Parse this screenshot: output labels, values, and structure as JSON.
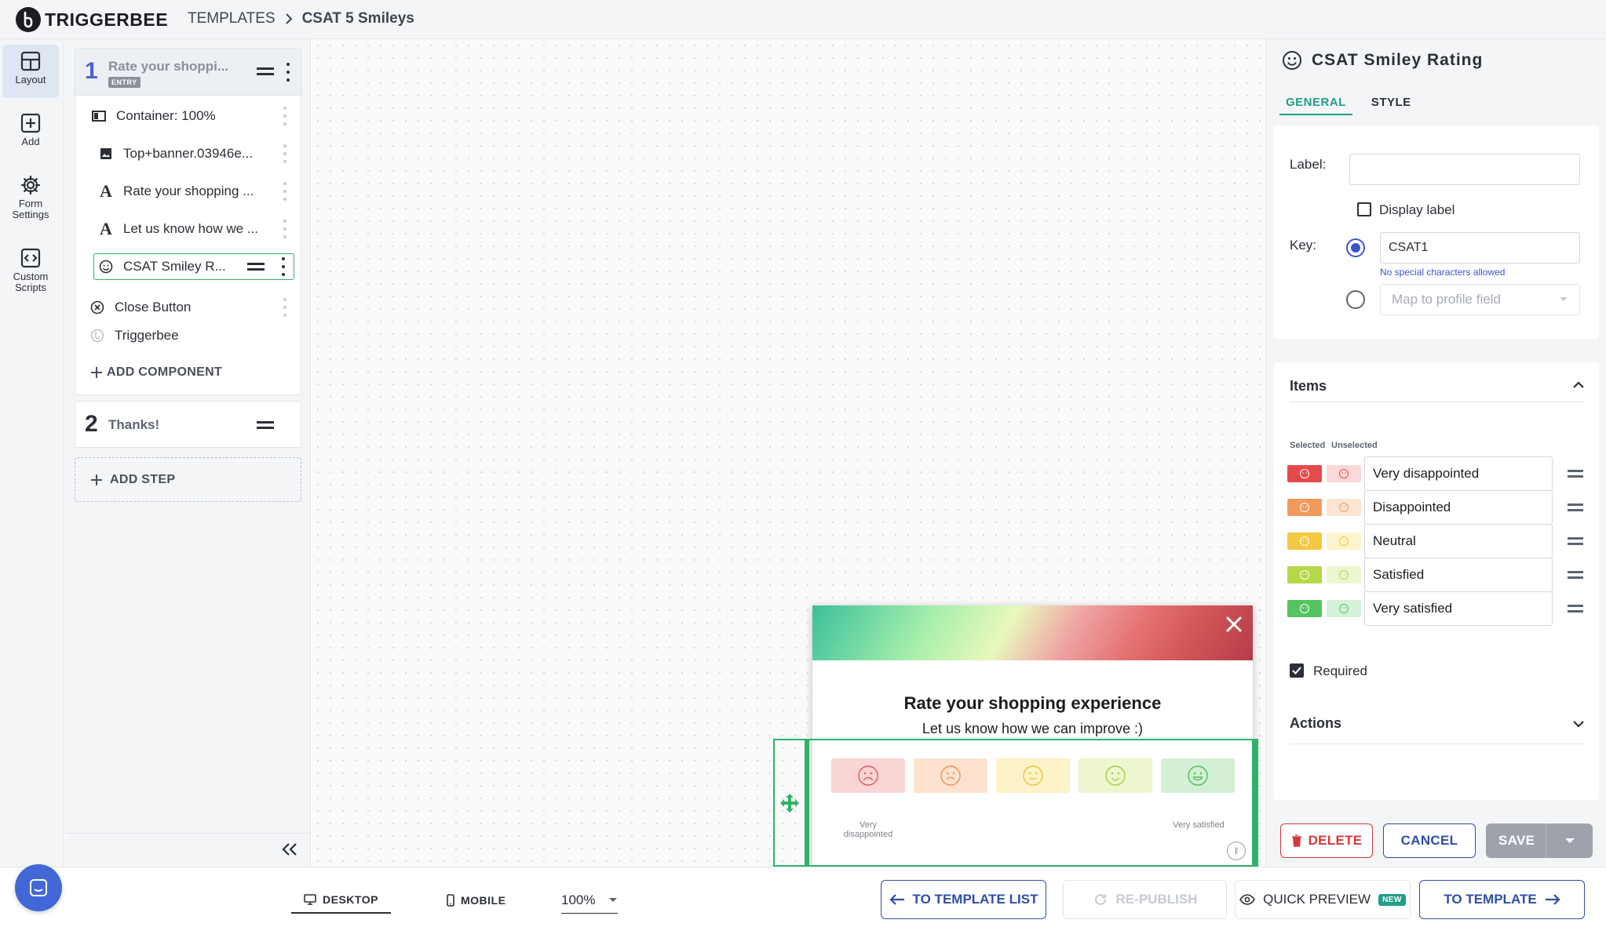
{
  "app": {
    "brand": "TRIGGERBEE"
  },
  "breadcrumb": {
    "root": "TEMPLATES",
    "separator": ">",
    "current": "CSAT 5 Smileys"
  },
  "rail": {
    "layout": "Layout",
    "add": "Add",
    "form_settings": "Form Settings",
    "custom_scripts": "Custom Scripts"
  },
  "steps": {
    "step1": {
      "number": "1",
      "title": "Rate your shoppi...",
      "badge": "ENTRY",
      "components": [
        {
          "label": "Container: 100%",
          "icon": "container-icon"
        },
        {
          "label": "Top+banner.03946e...",
          "icon": "image-icon"
        },
        {
          "label": "Rate your shopping ...",
          "icon": "text-icon"
        },
        {
          "label": "Let us know how we ...",
          "icon": "text-icon"
        },
        {
          "label": "CSAT Smiley R...",
          "icon": "smiley-icon"
        },
        {
          "label": "Close Button",
          "icon": "close-circle-icon"
        },
        {
          "label": "Triggerbee",
          "icon": "triggerbee-icon"
        }
      ],
      "add_component": "ADD COMPONENT"
    },
    "step2": {
      "number": "2",
      "title": "Thanks!"
    },
    "add_step": "ADD STEP"
  },
  "popup": {
    "title": "Rate your shopping experience",
    "subtitle": "Let us know how we can improve :)",
    "scale_low": "Very disappointed",
    "scale_high": "Very satisfied"
  },
  "props": {
    "title": "CSAT Smiley Rating",
    "tabs": {
      "general": "GENERAL",
      "style": "STYLE"
    },
    "general": {
      "label_field": "Label:",
      "label_value": "",
      "display_label": "Display label",
      "key_field": "Key:",
      "key_value": "CSAT1",
      "key_hint": "No special characters allowed",
      "map_placeholder": "Map to profile field"
    },
    "items": {
      "heading": "Items",
      "selected_lbl": "Selected",
      "unselected_lbl": "Unselected",
      "list": [
        {
          "label": "Very disappointed",
          "selected": "#e64b4b",
          "unselected": "#fbd9d9"
        },
        {
          "label": "Disappointed",
          "selected": "#f29a5c",
          "unselected": "#fde5d2"
        },
        {
          "label": "Neutral",
          "selected": "#f5c842",
          "unselected": "#fdf4cc"
        },
        {
          "label": "Satisfied",
          "selected": "#b5d848",
          "unselected": "#edf6cf"
        },
        {
          "label": "Very satisfied",
          "selected": "#55c460",
          "unselected": "#d6f1d8"
        }
      ],
      "required": "Required"
    },
    "actions_heading": "Actions",
    "buttons": {
      "delete": "DELETE",
      "cancel": "CANCEL",
      "save": "SAVE"
    }
  },
  "bottom": {
    "desktop": "DESKTOP",
    "mobile": "MOBILE",
    "zoom": "100%",
    "to_template_list": "TO TEMPLATE LIST",
    "republish": "RE-PUBLISH",
    "quick_preview": "QUICK PREVIEW",
    "new_badge": "NEW",
    "to_template": "TO TEMPLATE"
  }
}
